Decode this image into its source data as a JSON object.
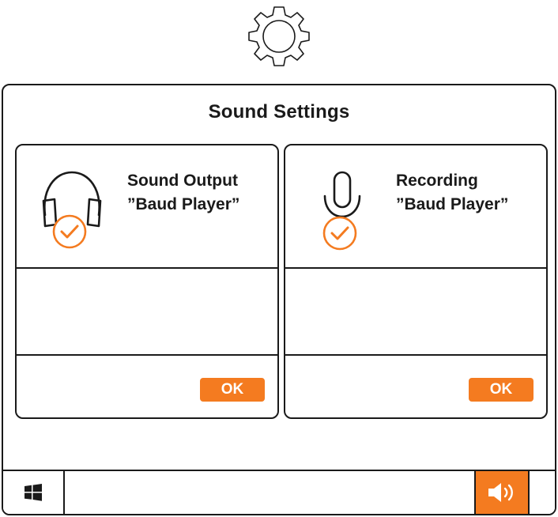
{
  "header": {
    "icon": "gear-icon"
  },
  "window": {
    "title": "Sound Settings"
  },
  "panels": [
    {
      "icon": "headphones-icon",
      "status_icon": "checkmark-circle-icon",
      "line1": "Sound Output",
      "line2": "”Baud Player”",
      "ok_label": "OK"
    },
    {
      "icon": "microphone-icon",
      "status_icon": "checkmark-circle-icon",
      "line1": "Recording",
      "line2": "”Baud Player”",
      "ok_label": "OK"
    }
  ],
  "taskbar": {
    "start_icon": "windows-logo-icon",
    "tray_icon": "speaker-volume-icon"
  },
  "colors": {
    "accent": "#f47b20",
    "stroke": "#1a1a1a",
    "background": "#ffffff"
  }
}
